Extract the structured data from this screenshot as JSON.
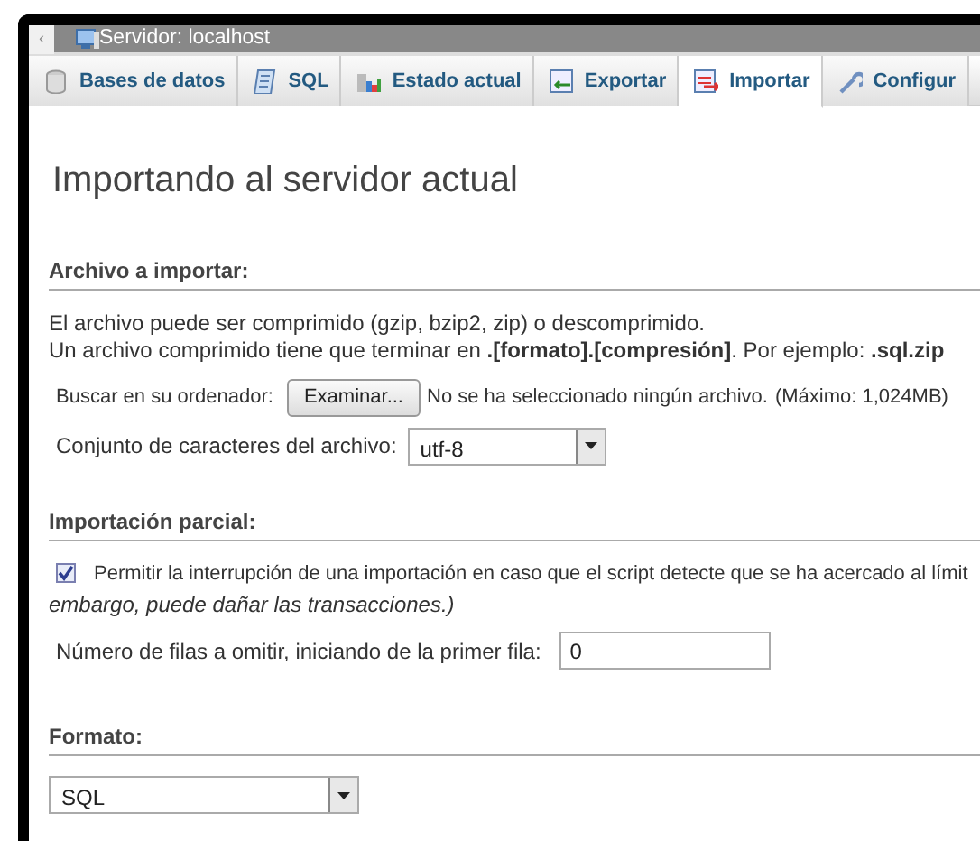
{
  "server_bar": {
    "back": "‹",
    "title": "Servidor: localhost"
  },
  "tabs": [
    {
      "label": "Bases de datos",
      "selected": false
    },
    {
      "label": "SQL",
      "selected": false
    },
    {
      "label": "Estado actual",
      "selected": false
    },
    {
      "label": "Exportar",
      "selected": false
    },
    {
      "label": "Importar",
      "selected": true
    },
    {
      "label": "Configur",
      "selected": false
    }
  ],
  "heading": "Importando al servidor actual",
  "file_section": {
    "title": "Archivo a importar:",
    "notes": [
      "El archivo puede ser comprimido (gzip, bzip2, zip) o descomprimido.",
      "Un archivo comprimido tiene que terminar en **.[formato].[compresión]**. Por ejemplo: **.sql.zip**"
    ],
    "browse_label": "Buscar en su ordenador:",
    "browse_button": "Examinar...",
    "no_file": "No se ha seleccionado ningún archivo.",
    "max_size": "(Máximo: 1,024MB)",
    "charset_label": "Conjunto de caracteres del archivo:",
    "charset_value": "utf-8"
  },
  "partial_section": {
    "title": "Importación parcial:",
    "allow_interrupt": {
      "checked": true,
      "text": "Permitir la interrupción de una importación en caso que el script detecte que se ha acercado al límit",
      "note": "embargo, puede dañar las transacciones.)"
    },
    "skip_label": "Número de filas a omitir, iniciando de la primer fila:",
    "skip_value": "0"
  },
  "format_section": {
    "title": "Formato:",
    "value": "SQL"
  }
}
